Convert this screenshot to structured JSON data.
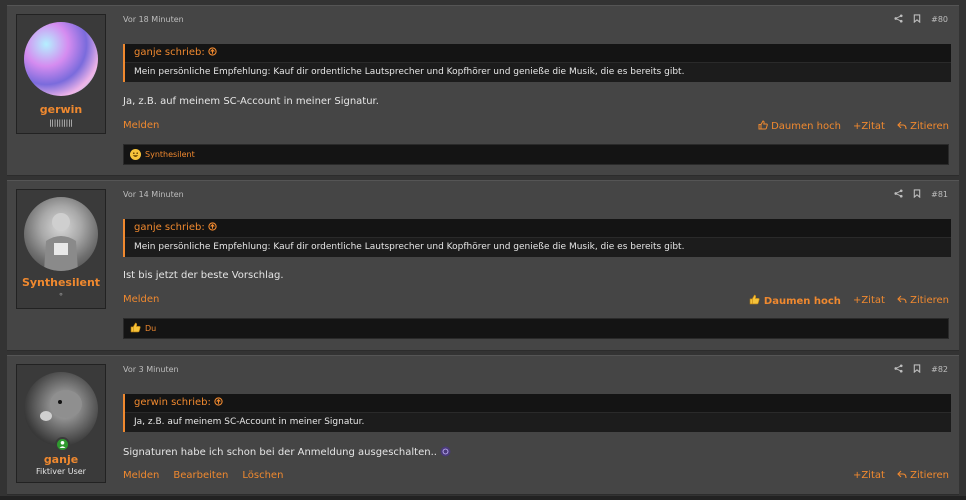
{
  "posts": [
    {
      "username": "gerwin",
      "user_title": "||||||||||",
      "time": "Vor 18 Minuten",
      "number": "#80",
      "quote_author": "ganje schrieb:",
      "quote_text": "Mein persönliche Empfehlung: Kauf dir ordentliche Lautsprecher und Kopfhörer und genieße die Musik, die es bereits gibt.",
      "message": "Ja, z.B. auf meinem SC-Account in meiner Signatur.",
      "left_actions": [
        "Melden"
      ],
      "like_label": "Daumen hoch",
      "quote_action": "Zitat",
      "reply_action": "Zitieren",
      "reactions": "Synthesilent"
    },
    {
      "username": "Synthesilent",
      "user_title": "⚬",
      "time": "Vor 14 Minuten",
      "number": "#81",
      "quote_author": "ganje schrieb:",
      "quote_text": "Mein persönliche Empfehlung: Kauf dir ordentliche Lautsprecher und Kopfhörer und genieße die Musik, die es bereits gibt.",
      "message": "Ist bis jetzt der beste Vorschlag.",
      "left_actions": [
        "Melden"
      ],
      "like_label": "Daumen hoch",
      "quote_action": "Zitat",
      "reply_action": "Zitieren",
      "reactions": "Du"
    },
    {
      "username": "ganje",
      "user_title": "Fiktiver User",
      "time": "Vor 3 Minuten",
      "number": "#82",
      "quote_author": "gerwin schrieb:",
      "quote_text": "Ja, z.B. auf meinem SC-Account in meiner Signatur.",
      "message": "Signaturen habe ich schon bei der Anmeldung ausgeschalten..",
      "left_actions": [
        "Melden",
        "Bearbeiten",
        "Löschen"
      ],
      "quote_action": "Zitat",
      "reply_action": "Zitieren"
    }
  ],
  "colors": {
    "accent": "#f0892f",
    "panel": "#454545",
    "quote_bg": "#141414"
  },
  "icons": [
    "share-icon",
    "bookmark-icon",
    "arrow-up-circle-icon",
    "thumbs-up-icon",
    "plus-icon",
    "reply-icon",
    "grin-emoji-icon",
    "online-status-icon"
  ]
}
